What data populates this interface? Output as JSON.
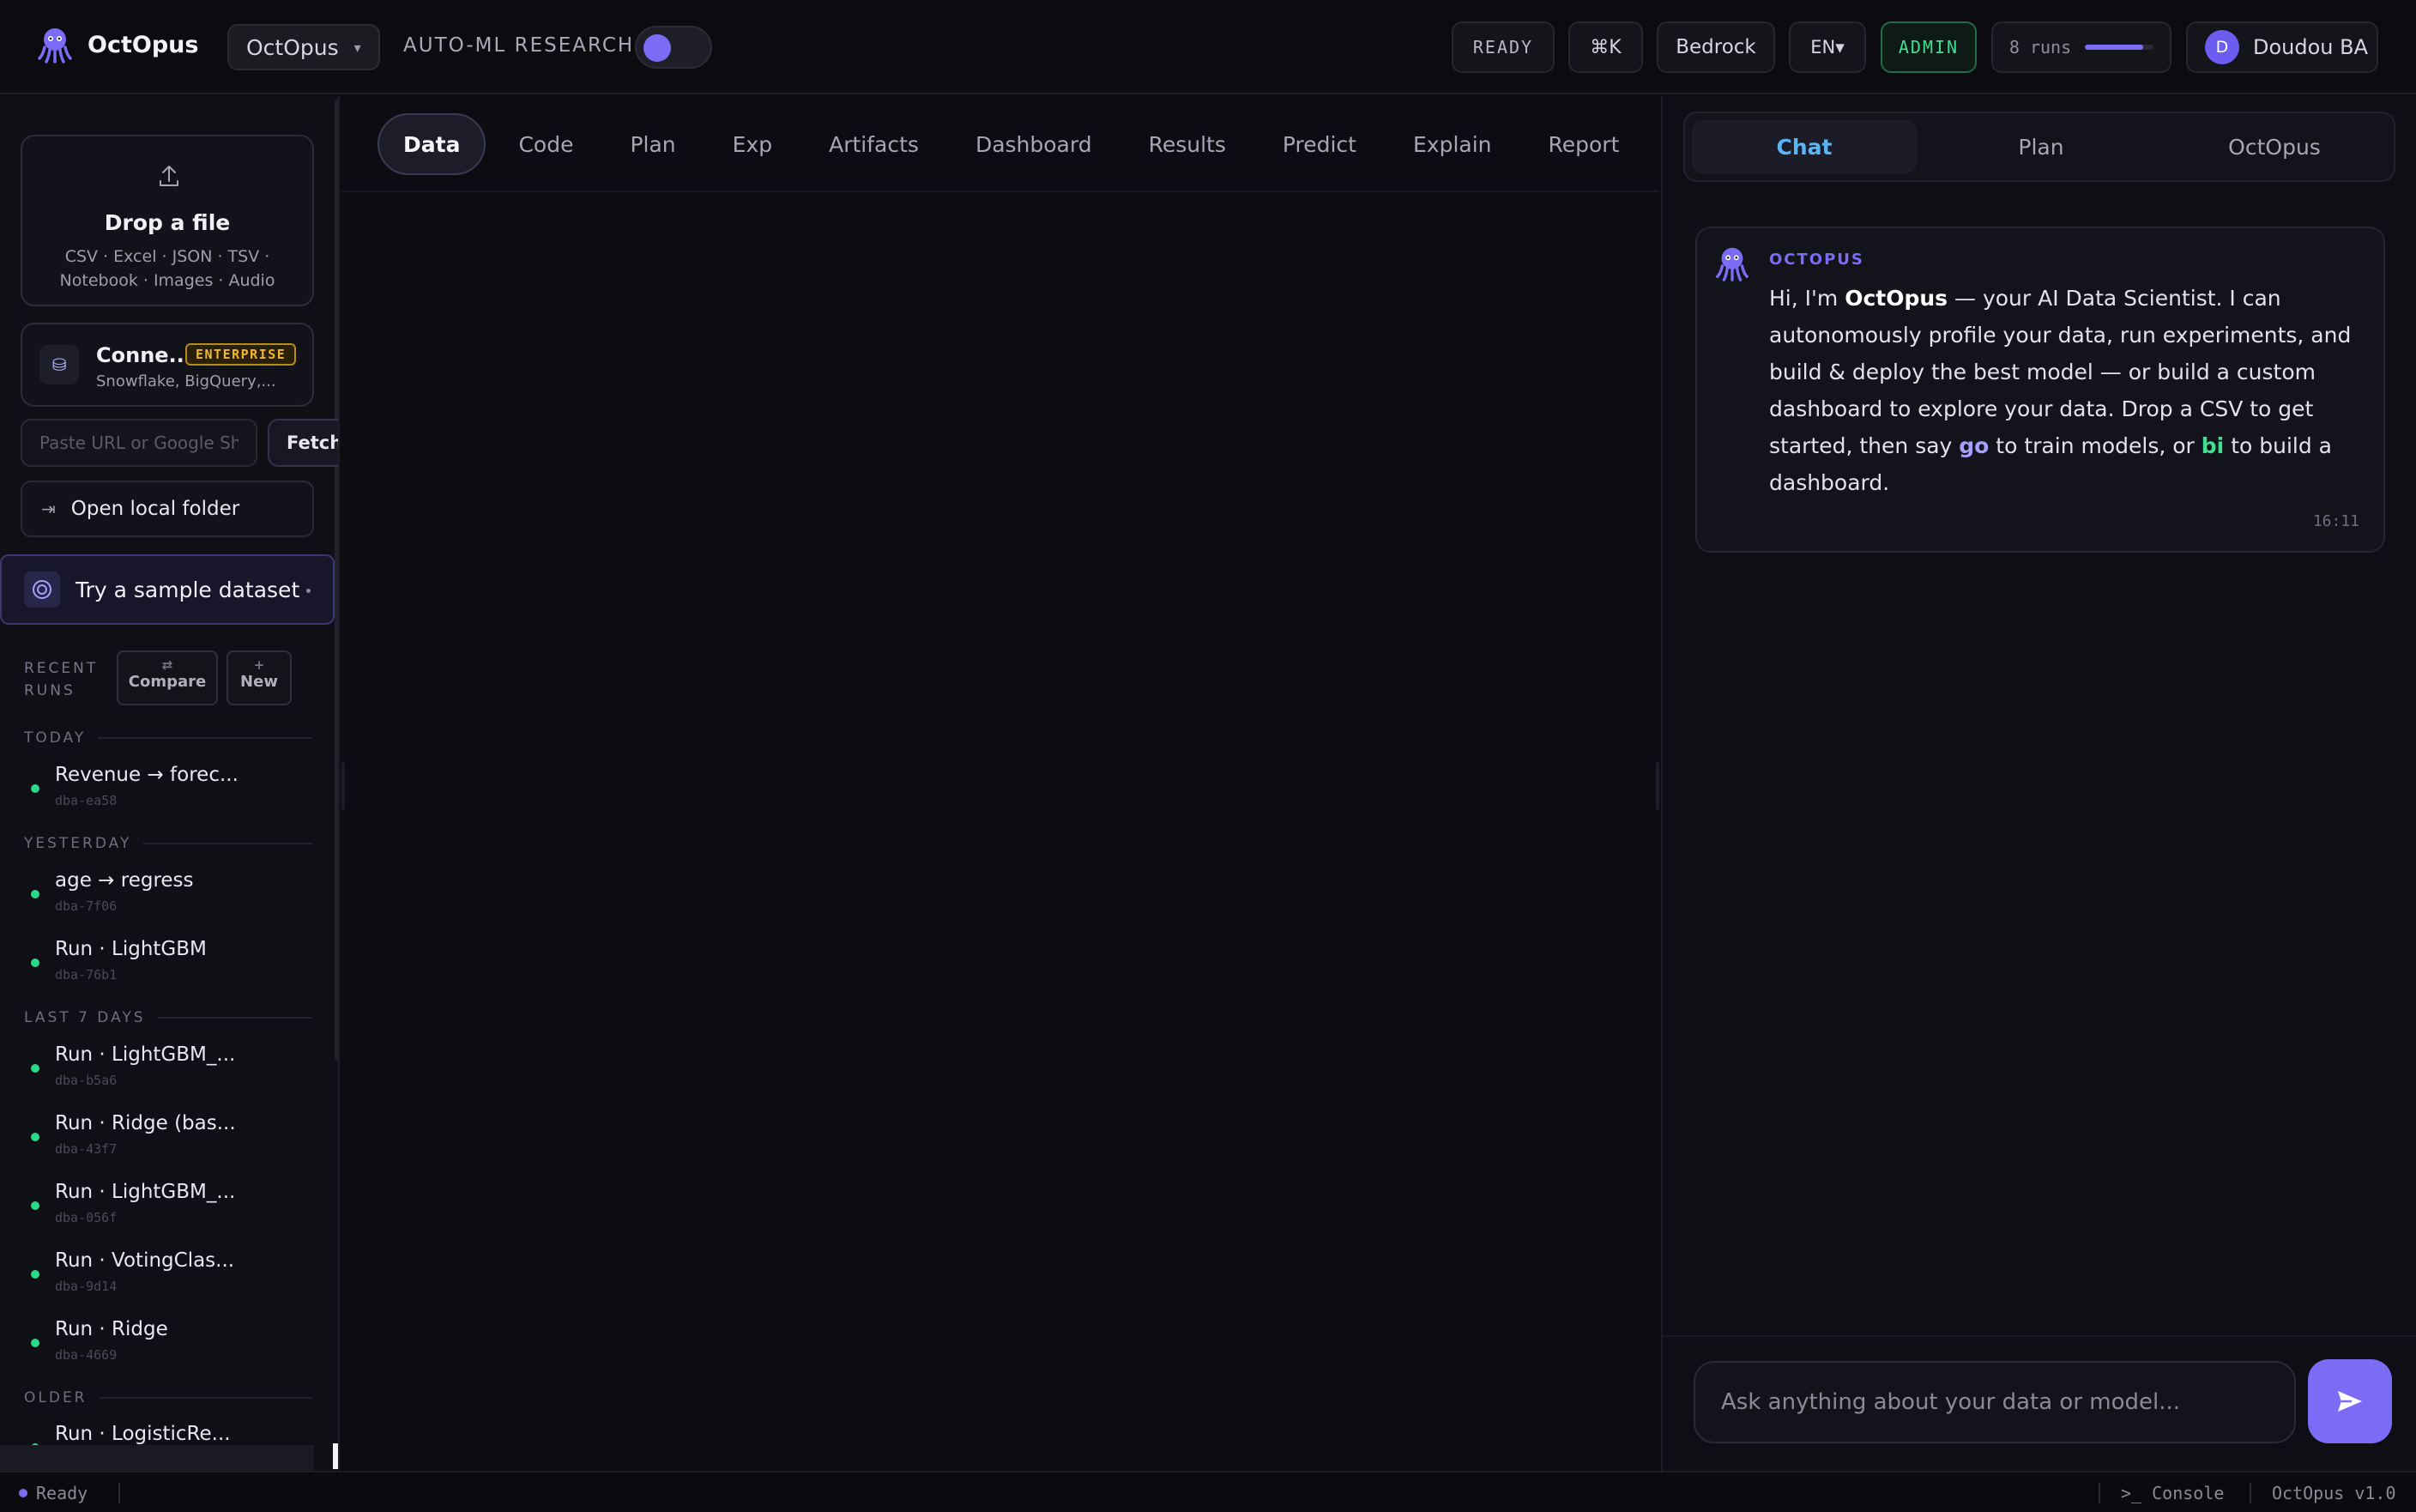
{
  "header": {
    "app_name": "OctOpus",
    "project": "OctOpus",
    "automl_label": "AUTO-ML RESEARCH",
    "automl_enabled": true,
    "status": "READY",
    "shortcut": "⌘K",
    "provider": "Bedrock",
    "language": "EN▾",
    "role": "ADMIN",
    "runs_label": "8 runs",
    "runs_progress": 0.85,
    "user_initial": "D",
    "user_name": "Doudou BA"
  },
  "sidebar": {
    "drop": {
      "title": "Drop a file",
      "formats": "CSV · Excel · JSON · TSV · Notebook · Images · Audio"
    },
    "connectors": {
      "title": "Conne...",
      "badge": "ENTERPRISE",
      "subtitle": "Snowflake, BigQuery,..."
    },
    "url_placeholder": "Paste URL or Google Sheet",
    "fetch_label": "Fetch",
    "open_folder_label": "Open local folder",
    "sample_label": "Try a sample dataset",
    "recent_label": "RECENT RUNS",
    "compare_label": "Compare",
    "compare_glyph": "⇄",
    "new_label": "New",
    "new_glyph": "+",
    "groups": [
      {
        "label": "TODAY",
        "runs": [
          {
            "name": "Revenue → forec...",
            "id": "dba-ea58"
          }
        ]
      },
      {
        "label": "YESTERDAY",
        "runs": [
          {
            "name": "age → regress",
            "id": "dba-7f06"
          },
          {
            "name": "Run · LightGBM",
            "id": "dba-76b1"
          }
        ]
      },
      {
        "label": "LAST 7 DAYS",
        "runs": [
          {
            "name": "Run · LightGBM_...",
            "id": "dba-b5a6"
          },
          {
            "name": "Run · Ridge (bas...",
            "id": "dba-43f7"
          },
          {
            "name": "Run · LightGBM_...",
            "id": "dba-056f"
          },
          {
            "name": "Run · VotingClas...",
            "id": "dba-9d14"
          },
          {
            "name": "Run · Ridge",
            "id": "dba-4669"
          }
        ]
      },
      {
        "label": "OLDER",
        "runs": [
          {
            "name": "Run · LogisticRe...",
            "id": ""
          }
        ]
      }
    ]
  },
  "main": {
    "tabs": [
      "Data",
      "Code",
      "Plan",
      "Exp",
      "Artifacts",
      "Dashboard",
      "Results",
      "Predict",
      "Explain",
      "Report"
    ],
    "active_tab": "Data"
  },
  "chat": {
    "tabs": [
      "Chat",
      "Plan",
      "OctOpus"
    ],
    "active_tab": "Chat",
    "message": {
      "author": "OCTOPUS",
      "p1": "Hi, I'm ",
      "brand": "OctOpus",
      "p2": " — your AI Data Scientist. I can autonomously profile your data, run experiments, and build & deploy the best model — or build a custom dashboard to explore your data. Drop a CSV to get started, then say ",
      "kw1": "go",
      "p3": " to train models, or ",
      "kw2": "bi",
      "p4": " to build a dashboard.",
      "time": "16:11"
    },
    "input_placeholder": "Ask anything about your data or model..."
  },
  "statusbar": {
    "status": "Ready",
    "console": ">_ Console",
    "version": "OctOpus v1.0"
  },
  "colors": {
    "accent": "#7c6cf5",
    "success": "#2ed889",
    "enterprise": "#f0b62c",
    "chat_active": "#5ab5f5"
  }
}
